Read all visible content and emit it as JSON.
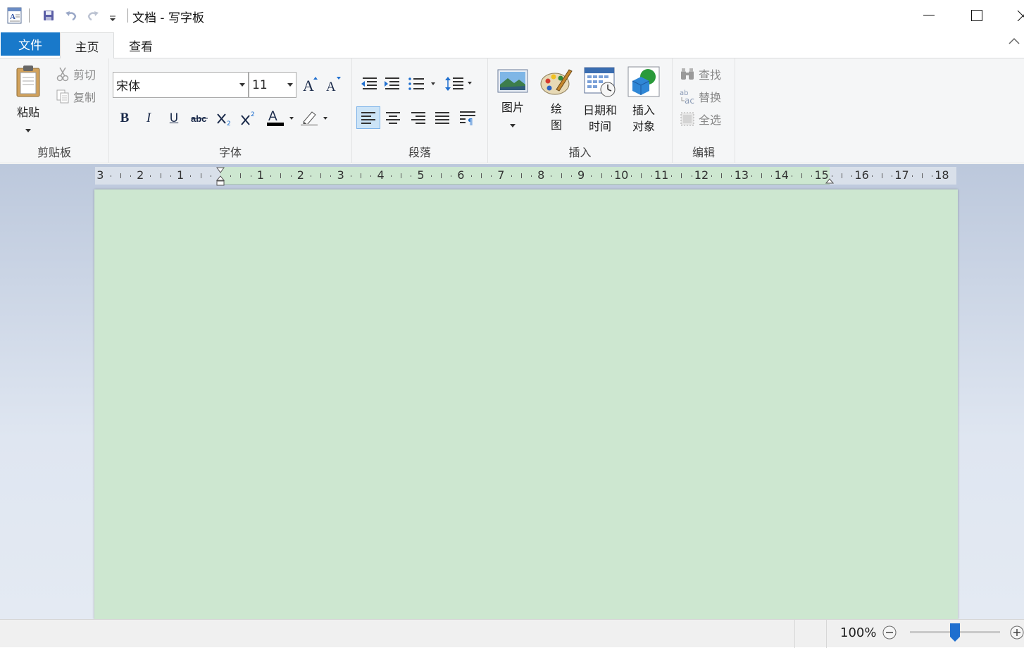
{
  "window": {
    "title": "文档 - 写字板",
    "accent": "#1979ca",
    "page_color": "#cde7d0"
  },
  "tabs": [
    {
      "label": "文件"
    },
    {
      "label": "主页"
    },
    {
      "label": "查看"
    }
  ],
  "ribbon": {
    "clipboard": {
      "group_label": "剪贴板",
      "paste": "粘贴",
      "cut": "剪切",
      "copy": "复制"
    },
    "font": {
      "group_label": "字体",
      "font_name": "宋体",
      "font_size": "11"
    },
    "paragraph": {
      "group_label": "段落"
    },
    "insert": {
      "group_label": "插入",
      "picture": "图片",
      "paint_line1": "绘",
      "paint_line2": "图",
      "datetime_line1": "日期和",
      "datetime_line2": "时间",
      "object_line1": "插入",
      "object_line2": "对象"
    },
    "edit": {
      "group_label": "编辑",
      "find": "查找",
      "replace": "替换",
      "select_all": "全选"
    }
  },
  "ruler": {
    "labels": [
      "3",
      "2",
      "1",
      "1",
      "2",
      "3",
      "4",
      "5",
      "6",
      "7",
      "8",
      "9",
      "10",
      "11",
      "12",
      "13",
      "14",
      "15",
      "16",
      "17",
      "18"
    ]
  },
  "status": {
    "zoom": "100%",
    "zoom_level_percent": 100
  }
}
